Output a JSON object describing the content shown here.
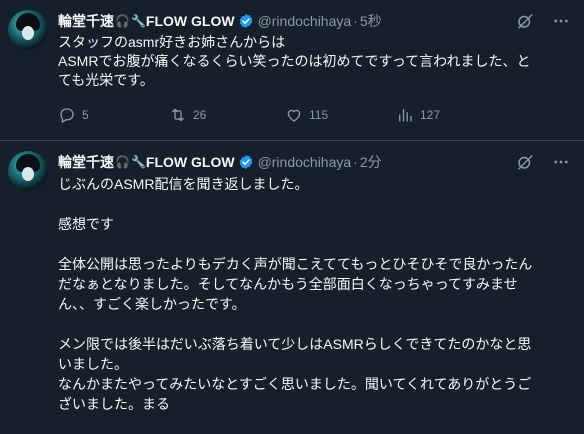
{
  "posts": [
    {
      "author_name": "輪堂千速",
      "author_suffix": "FLOW GLOW",
      "handle": "@rindochihaya",
      "separator": "·",
      "time": "5秒",
      "lines": [
        "スタッフのasmr好きお姉さんからは",
        "ASMRでお腹が痛くなるくらい笑ったのは初めてですって言われました、と",
        "ても光栄です。"
      ],
      "replies": "5",
      "retweets": "26",
      "likes": "115",
      "views": "127"
    },
    {
      "author_name": "輪堂千速",
      "author_suffix": "FLOW GLOW",
      "handle": "@rindochihaya",
      "separator": "·",
      "time": "2分",
      "lines": [
        "じぶんのASMR配信を聞き返しました。",
        "",
        "感想です",
        "",
        "全体公開は思ったよりもデカく声が聞こえててもっとひそひそで良かったん",
        "だなぁとなりました。そしてなんかもう全部面白くなっちゃってすみませ",
        "ん、、すごく楽しかったです。",
        "",
        "メン限では後半はだいぶ落ち着いて少しはASMRらしくできてたのかなと思",
        "いました。",
        "なんかまたやってみたいなとすごく思いました。聞いてくれてありがとうご",
        "ざいました。まる"
      ]
    }
  ],
  "colors": {
    "background": "#15202b",
    "text": "#f7f9f9",
    "muted": "#8b98a5",
    "verified": "#1d9bf0",
    "divider": "#38444d"
  },
  "icons": [
    "headphone-icon",
    "wrench-icon",
    "verified-icon",
    "grok-icon",
    "more-icon",
    "reply-icon",
    "retweet-icon",
    "like-icon",
    "views-icon"
  ]
}
